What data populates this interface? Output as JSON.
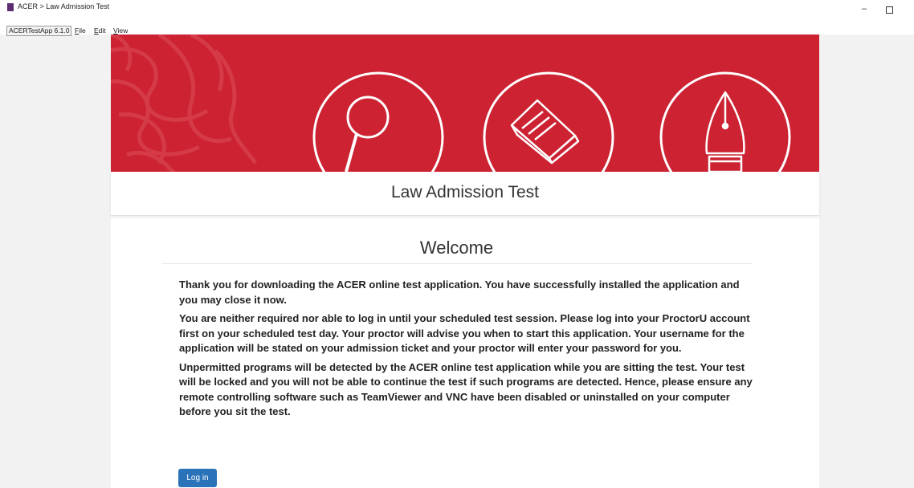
{
  "window": {
    "title": "ACER > Law Admission Test",
    "minimize_glyph": "–",
    "restore_glyph": "▢"
  },
  "menubar": {
    "app_name": "ACERTestApp 6.1.0",
    "items": [
      {
        "mnemonic": "F",
        "rest": "ile"
      },
      {
        "mnemonic": "E",
        "rest": "dit"
      },
      {
        "mnemonic": "V",
        "rest": "iew"
      }
    ]
  },
  "header": {
    "title": "Law Admission Test",
    "banner_color": "#cc2232",
    "icons": [
      "magnifier-icon",
      "book-icon",
      "fountain-pen-icon"
    ]
  },
  "main": {
    "heading": "Welcome",
    "paragraphs": [
      "Thank you for downloading the ACER online test application. You have successfully installed the application and you may close it now.",
      "You are neither required nor able to log in until your scheduled test session. Please log into your ProctorU account first on your scheduled test day. Your proctor will advise you when to start this application. Your username for the application will be stated on your admission ticket and your proctor will enter your password for you.",
      "Unpermitted programs will be detected by the ACER online test application while you are sitting the test. Your test will be locked and you will not be able to continue the test if such programs are detected. Hence, please ensure any remote controlling software such as TeamViewer and VNC have been disabled or uninstalled on your computer before you sit the test."
    ],
    "login_label": "Log in",
    "login_color": "#2a73b8"
  }
}
